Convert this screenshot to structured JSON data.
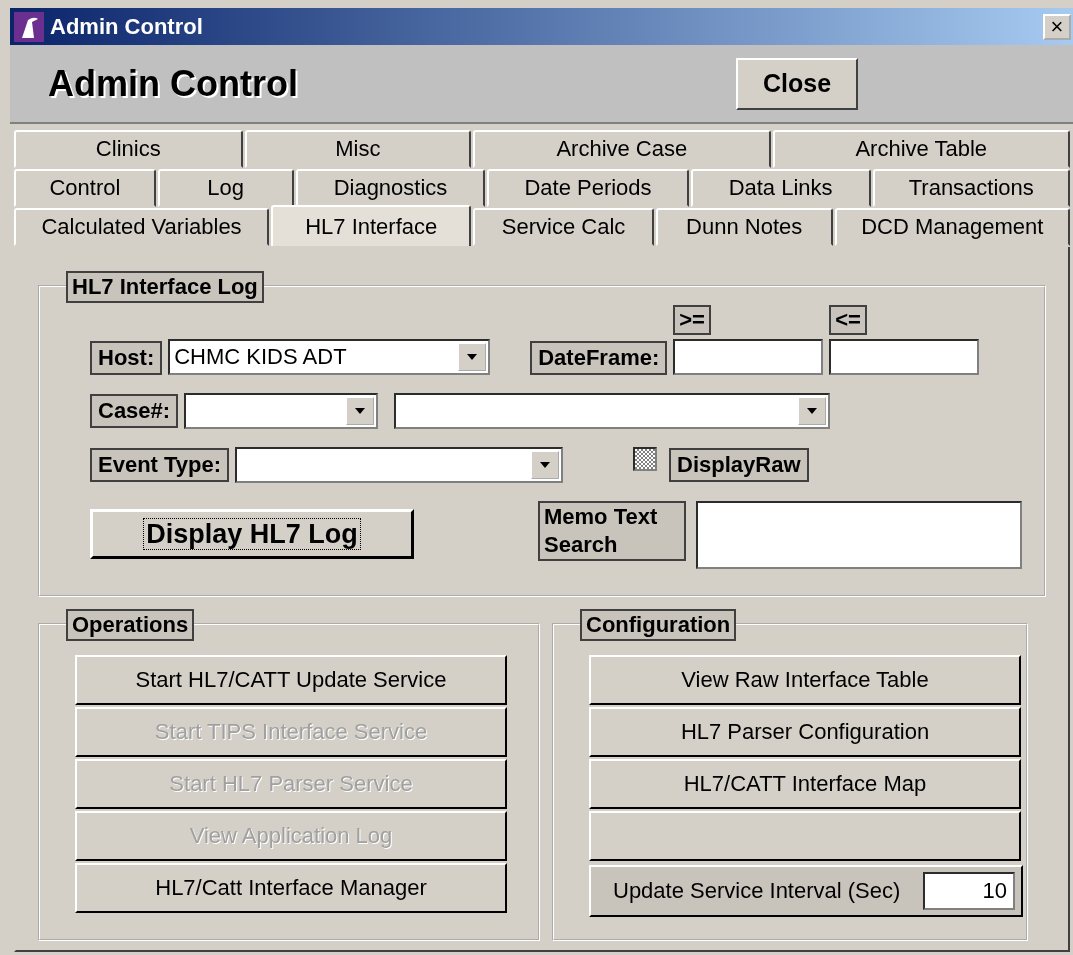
{
  "window": {
    "title": "Admin Control",
    "close_glyph": "×"
  },
  "header": {
    "title": "Admin Control",
    "close_button": "Close"
  },
  "tab_rows": [
    [
      {
        "label": "Clinics",
        "selected": false
      },
      {
        "label": "Misc",
        "selected": false
      },
      {
        "label": "Archive Case",
        "selected": false
      },
      {
        "label": "Archive Table",
        "selected": false
      }
    ],
    [
      {
        "label": "Control",
        "selected": false
      },
      {
        "label": "Log",
        "selected": false
      },
      {
        "label": "Diagnostics",
        "selected": false
      },
      {
        "label": "Date Periods",
        "selected": false
      },
      {
        "label": "Data Links",
        "selected": false
      },
      {
        "label": "Transactions",
        "selected": false
      }
    ],
    [
      {
        "label": "Calculated Variables",
        "selected": false
      },
      {
        "label": "HL7 Interface",
        "selected": true
      },
      {
        "label": "Service Calc",
        "selected": false
      },
      {
        "label": "Dunn Notes",
        "selected": false
      },
      {
        "label": "DCD Management",
        "selected": false
      }
    ]
  ],
  "log_group": {
    "title": "HL7 Interface Log",
    "host": {
      "label": "Host:",
      "value": "CHMC KIDS ADT"
    },
    "dateframe": {
      "label": "DateFrame:",
      "from_label": ">=",
      "to_label": "<="
    },
    "case": {
      "label": "Case#:"
    },
    "event_type": {
      "label": "Event Type:"
    },
    "display_raw": {
      "label": "DisplayRaw",
      "indeterminate": true
    },
    "display_button": "Display HL7 Log",
    "memo": {
      "label": "Memo Text Search"
    }
  },
  "operations": {
    "title": "Operations",
    "buttons": [
      {
        "label": "Start HL7/CATT Update Service",
        "disabled": false
      },
      {
        "label": "Start TIPS Interface Service",
        "disabled": true
      },
      {
        "label": "Start HL7 Parser Service",
        "disabled": true
      },
      {
        "label": "View Application Log",
        "disabled": true
      },
      {
        "label": "HL7/Catt Interface Manager",
        "disabled": false
      }
    ]
  },
  "configuration": {
    "title": "Configuration",
    "buttons": [
      {
        "kind": "action",
        "label": "View Raw Interface Table"
      },
      {
        "kind": "action",
        "label": "HL7 Parser Configuration"
      },
      {
        "kind": "action",
        "label": "HL7/CATT Interface Map"
      },
      {
        "kind": "blank"
      }
    ],
    "interval": {
      "label": "Update Service Interval (Sec)",
      "value": "10"
    }
  }
}
